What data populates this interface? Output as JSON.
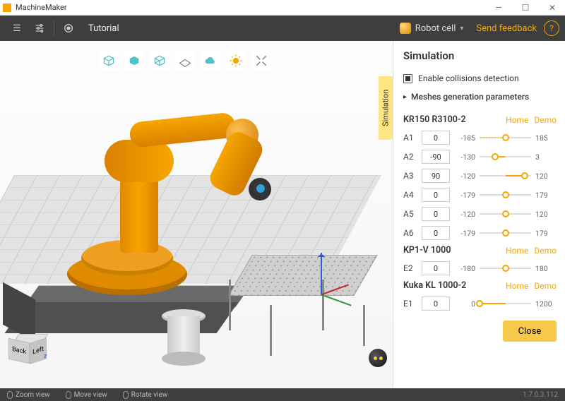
{
  "app": {
    "title": "MachineMaker"
  },
  "toolbar": {
    "tutorial": "Tutorial",
    "robot_cell": "Robot cell",
    "send_feedback": "Send feedback"
  },
  "viewport": {
    "sim_tab": "Simulation",
    "nav_cube": {
      "front": "Back",
      "side": "Left"
    },
    "mini_axis": "z"
  },
  "panel": {
    "title": "Simulation",
    "enable_collisions": "Enable collisions detection",
    "meshes_params": "Meshes generation parameters",
    "home": "Home",
    "demo": "Demo",
    "close": "Close",
    "groups": [
      {
        "name": "KR150 R3100-2",
        "axes": [
          {
            "label": "A1",
            "value": 0,
            "min": -185,
            "max": 185,
            "has_dots": true
          },
          {
            "label": "A2",
            "value": -90,
            "min": -130,
            "max": 3
          },
          {
            "label": "A3",
            "value": 90,
            "min": -120,
            "max": 120
          },
          {
            "label": "A4",
            "value": 0,
            "min": -179,
            "max": 179
          },
          {
            "label": "A5",
            "value": 0,
            "min": -120,
            "max": 120
          },
          {
            "label": "A6",
            "value": 0,
            "min": -179,
            "max": 179
          }
        ]
      },
      {
        "name": "KP1-V 1000",
        "axes": [
          {
            "label": "E2",
            "value": 0,
            "min": -180,
            "max": 180
          }
        ]
      },
      {
        "name": "Kuka KL 1000-2",
        "axes": [
          {
            "label": "E1",
            "value": 0,
            "min": 0,
            "max": 1200
          }
        ]
      }
    ]
  },
  "status": {
    "zoom": "Zoom view",
    "move": "Move view",
    "rotate": "Rotate view",
    "version": "1.7.0.3.112"
  }
}
